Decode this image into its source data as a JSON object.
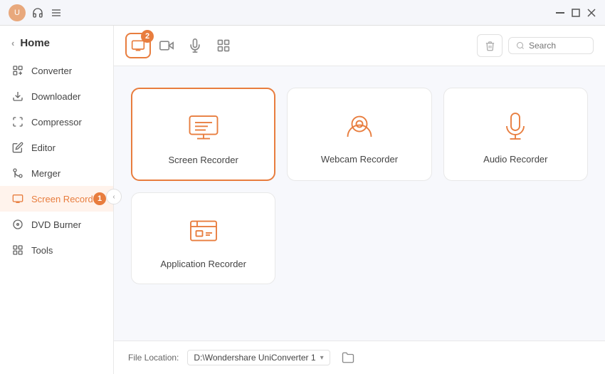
{
  "titlebar": {
    "icons": {
      "headphone": "🎧",
      "menu": "≡"
    },
    "controls": {
      "minimize": "─",
      "maximize": "□",
      "close": "✕"
    }
  },
  "sidebar": {
    "home_label": "Home",
    "items": [
      {
        "id": "converter",
        "label": "Converter",
        "active": false
      },
      {
        "id": "downloader",
        "label": "Downloader",
        "active": false
      },
      {
        "id": "compressor",
        "label": "Compressor",
        "active": false
      },
      {
        "id": "editor",
        "label": "Editor",
        "active": false
      },
      {
        "id": "merger",
        "label": "Merger",
        "active": false
      },
      {
        "id": "screen-recorder",
        "label": "Screen Recorder",
        "active": true
      },
      {
        "id": "dvd-burner",
        "label": "DVD Burner",
        "active": false
      },
      {
        "id": "tools",
        "label": "Tools",
        "active": false
      }
    ],
    "badge_1_value": "1"
  },
  "toolbar": {
    "tabs": [
      {
        "id": "screen",
        "active": true,
        "badge": "2"
      },
      {
        "id": "webcam",
        "active": false
      },
      {
        "id": "audio",
        "active": false
      },
      {
        "id": "apps",
        "active": false
      }
    ],
    "delete_btn_title": "Delete",
    "search_placeholder": "Search"
  },
  "recorders": [
    {
      "id": "screen-recorder",
      "label": "Screen Recorder",
      "active": true
    },
    {
      "id": "webcam-recorder",
      "label": "Webcam Recorder",
      "active": false
    },
    {
      "id": "audio-recorder",
      "label": "Audio Recorder",
      "active": false
    },
    {
      "id": "application-recorder",
      "label": "Application Recorder",
      "active": false
    }
  ],
  "toolbar_badge_2": "2",
  "footer": {
    "label": "File Location:",
    "path": "D:\\Wondershare UniConverter 1",
    "chevron": "▾"
  },
  "colors": {
    "accent": "#e87d3e",
    "active_bg": "#fff3ec"
  }
}
